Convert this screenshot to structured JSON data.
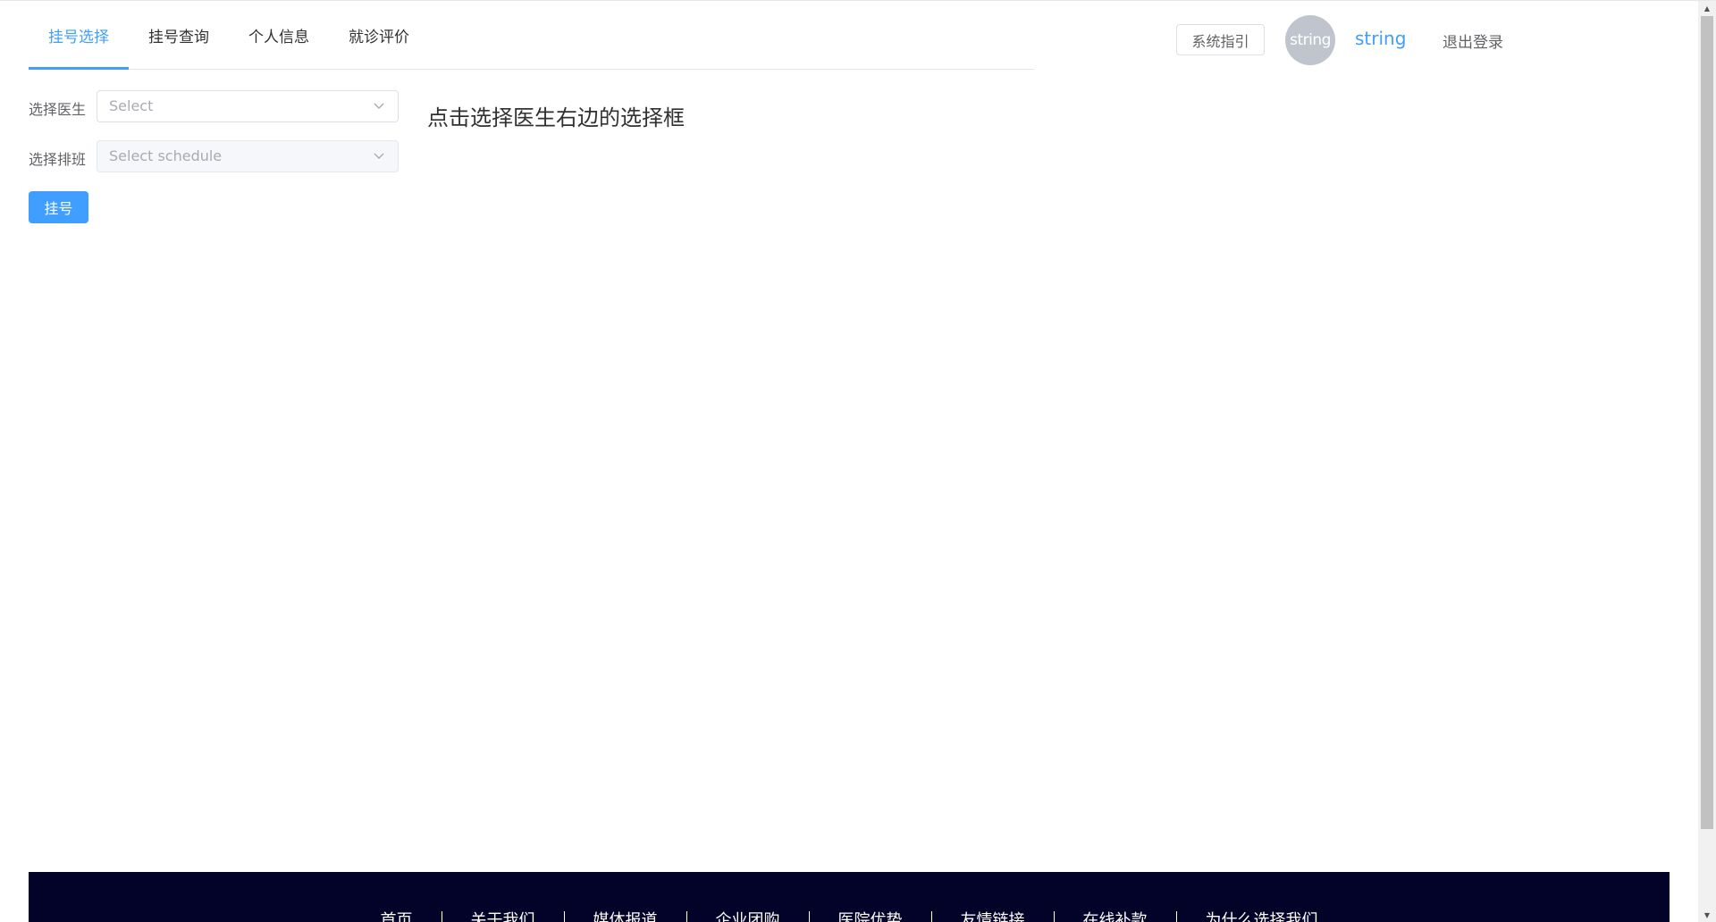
{
  "tabs": [
    {
      "label": "挂号选择",
      "active": true
    },
    {
      "label": "挂号查询",
      "active": false
    },
    {
      "label": "个人信息",
      "active": false
    },
    {
      "label": "就诊评价",
      "active": false
    }
  ],
  "header": {
    "guide_label": "系统指引",
    "avatar_text": "string",
    "username": "string",
    "logout_label": "退出登录"
  },
  "form": {
    "doctor_label": "选择医生",
    "doctor_placeholder": "Select",
    "schedule_label": "选择排班",
    "schedule_placeholder": "Select schedule",
    "submit_label": "挂号"
  },
  "hint": "点击选择医生右边的选择框",
  "footer": {
    "links": [
      "首页",
      "关于我们",
      "媒体报道",
      "企业团购",
      "医院优势",
      "友情链接",
      "在线补款",
      "为什么选择我们"
    ]
  },
  "colors": {
    "accent": "#409eff",
    "footer_bg": "#03032a"
  }
}
